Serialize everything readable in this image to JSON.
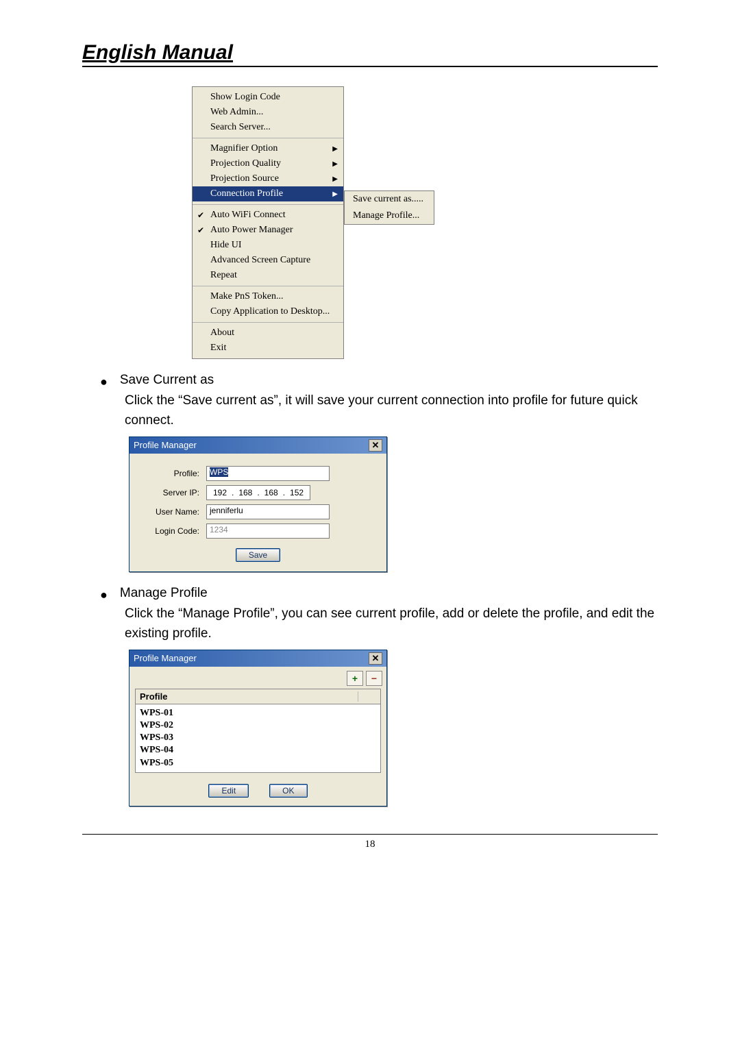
{
  "header": {
    "title": "English Manual"
  },
  "menu": {
    "items": [
      {
        "label": "Show Login Code"
      },
      {
        "label": "Web Admin..."
      },
      {
        "label": "Search Server..."
      },
      {
        "label": "Magnifier Option",
        "submenu": true
      },
      {
        "label": "Projection Quality",
        "submenu": true
      },
      {
        "label": "Projection Source",
        "submenu": true
      },
      {
        "label": "Connection Profile",
        "submenu": true,
        "highlight": true
      },
      {
        "label": "Auto WiFi Connect",
        "checked": true
      },
      {
        "label": "Auto Power Manager",
        "checked": true
      },
      {
        "label": "Hide UI"
      },
      {
        "label": "Advanced Screen Capture"
      },
      {
        "label": "Repeat"
      },
      {
        "label": "Make PnS Token..."
      },
      {
        "label": "Copy Application to Desktop..."
      },
      {
        "label": "About"
      },
      {
        "label": "Exit"
      }
    ],
    "submenu": [
      "Save current as.....",
      "Manage Profile..."
    ]
  },
  "section1": {
    "heading": "Save Current as",
    "body": "Click the “Save current as”, it will save your current connection into profile for future quick connect."
  },
  "dialog1": {
    "title": "Profile Manager",
    "labels": {
      "profile": "Profile:",
      "serverip": "Server IP:",
      "username": "User Name:",
      "logincode": "Login Code:"
    },
    "values": {
      "profile": "WPS",
      "ip": [
        "192",
        "168",
        "168",
        "152"
      ],
      "username": "jenniferlu",
      "logincode": "1234"
    },
    "save": "Save"
  },
  "section2": {
    "heading": "Manage Profile",
    "body": "Click the “Manage Profile”, you can see current profile, add or delete the profile, and edit the existing profile."
  },
  "dialog2": {
    "title": "Profile Manager",
    "column": "Profile",
    "rows": [
      "WPS-01",
      "WPS-02",
      "WPS-03",
      "WPS-04",
      "WPS-05"
    ],
    "edit": "Edit",
    "ok": "OK"
  },
  "page_number": "18"
}
